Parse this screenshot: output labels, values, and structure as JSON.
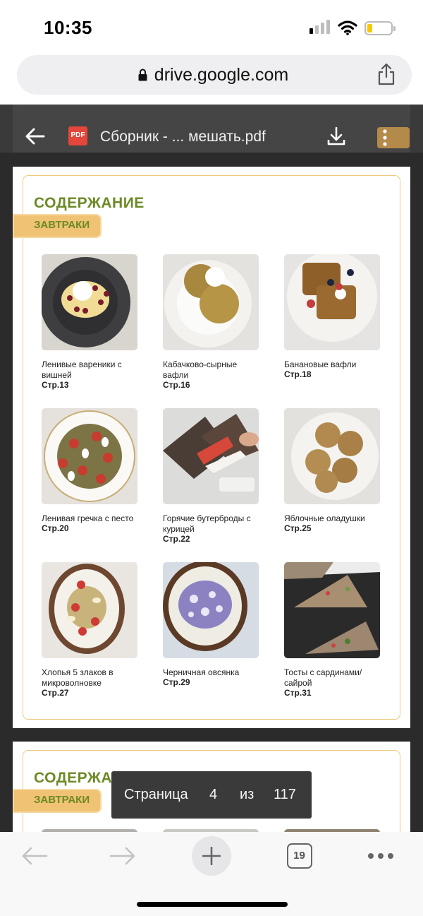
{
  "status_bar": {
    "time": "10:35"
  },
  "browser": {
    "url": "drive.google.com"
  },
  "pdf_viewer": {
    "file_icon_label": "PDF",
    "title": "Сборник - ... мешать.pdf",
    "page_indicator": {
      "label": "Страница",
      "current": "4",
      "separator": "из",
      "total": "117"
    }
  },
  "pages": [
    {
      "heading": "СОДЕРЖАНИЕ",
      "ribbon": "ЗАВТРАКИ",
      "items": [
        {
          "name": "Ленивые вареники с вишней",
          "page": "Стр.13",
          "icon": "dumplings-photo"
        },
        {
          "name": "Кабачково-сырные вафли",
          "page": "Стр.16",
          "icon": "zucchini-waffles-photo"
        },
        {
          "name": "Банановые вафли",
          "page": "Стр.18",
          "icon": "banana-waffles-photo"
        },
        {
          "name": "Ленивая гречка с песто",
          "page": "Стр.20",
          "icon": "buckwheat-pesto-photo"
        },
        {
          "name": "Горячие бутерброды с курицей",
          "page": "Стр.22",
          "icon": "hot-sandwiches-photo"
        },
        {
          "name": "Яблочные оладушки",
          "page": "Стр.25",
          "icon": "apple-pancakes-photo"
        },
        {
          "name": "Хлопья 5 злаков в микроволновке",
          "page": "Стр.27",
          "icon": "cereal-bowl-photo"
        },
        {
          "name": "Черничная овсянка",
          "page": "Стр.29",
          "icon": "blueberry-oatmeal-photo"
        },
        {
          "name": "Тосты с сардинами/ сайрой",
          "page": "Стр.31",
          "icon": "sardine-toasts-photo"
        }
      ]
    },
    {
      "heading": "СОДЕРЖАНИЕ",
      "ribbon": "ЗАВТРАКИ"
    }
  ],
  "bottom_bar": {
    "tab_count": "19"
  },
  "colors": {
    "heading_green": "#6c8a26",
    "ribbon_orange": "#f0c273",
    "frame_orange": "#efc97f",
    "pdf_red": "#e3463a"
  }
}
